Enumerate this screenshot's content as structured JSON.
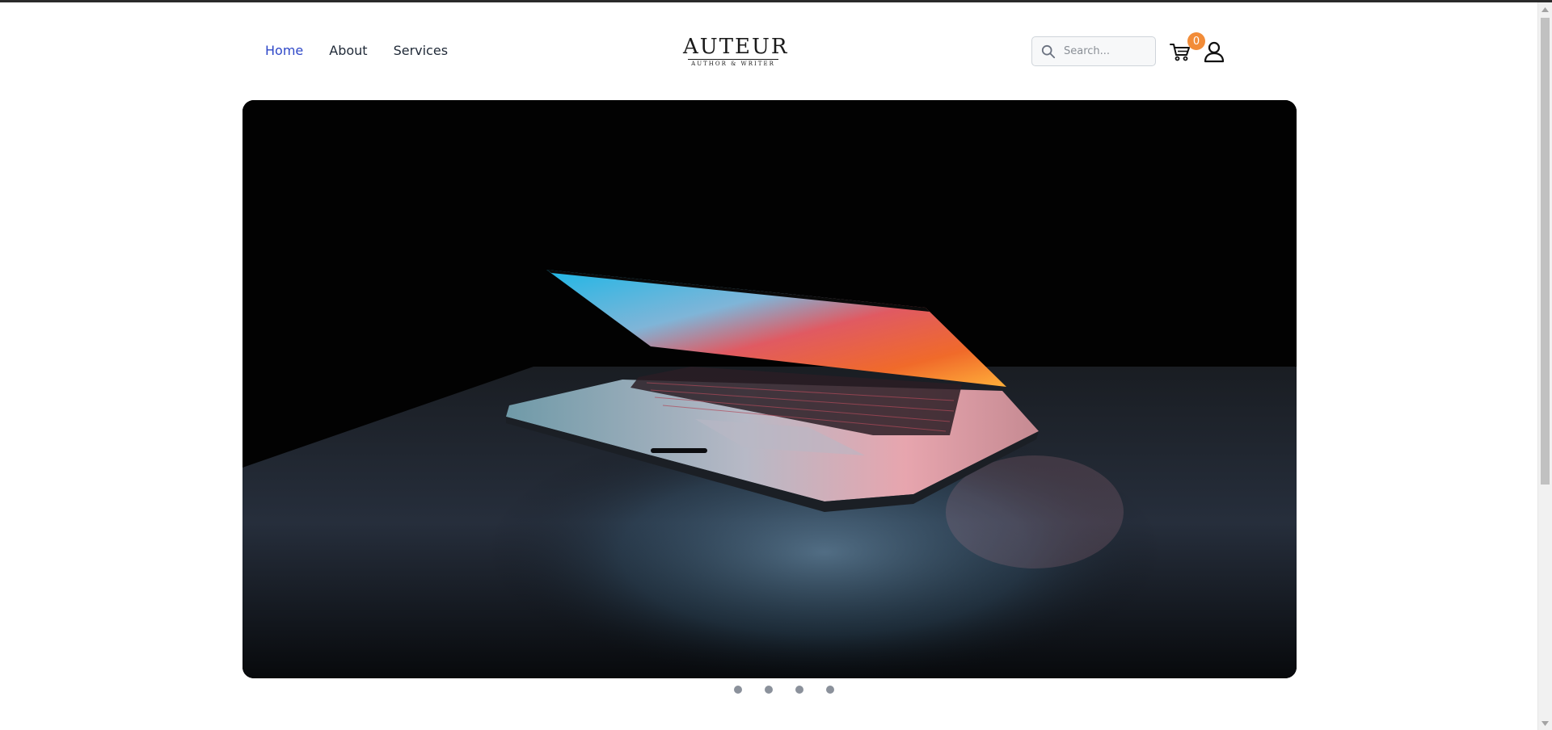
{
  "nav": {
    "items": [
      {
        "label": "Home",
        "active": true
      },
      {
        "label": "About",
        "active": false
      },
      {
        "label": "Services",
        "active": false
      }
    ],
    "active_color": "#2f48c8"
  },
  "logo": {
    "title": "AUTEUR",
    "subtitle": "AUTHOR & WRITER"
  },
  "search": {
    "placeholder": "Search...",
    "value": ""
  },
  "cart": {
    "count": "0",
    "badge_color": "#f28c38"
  },
  "icons": {
    "search": "search-icon",
    "cart": "cart-icon",
    "user": "user-icon"
  },
  "hero": {
    "image": "laptop-dark-photo"
  },
  "carousel": {
    "slide_count": 4
  }
}
